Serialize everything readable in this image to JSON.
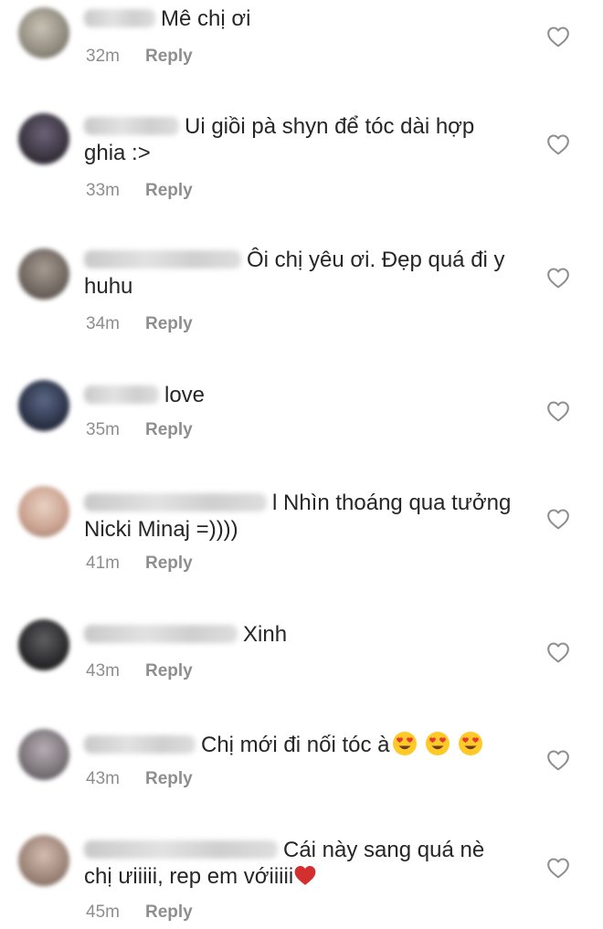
{
  "comments": [
    {
      "text": "Mê chị ơi",
      "time": "32m",
      "reply": "Reply",
      "avatar_color": "#8f8a7e"
    },
    {
      "text": "Ui giồi pà shyn để tóc dài hợp ghia :>",
      "time": "33m",
      "reply": "Reply",
      "avatar_color": "#3a3440"
    },
    {
      "text": "Ôi chị yêu ơi. Đẹp quá đi y huhu",
      "time": "34m",
      "reply": "Reply",
      "avatar_color": "#6f6660"
    },
    {
      "text": "love",
      "time": "35m",
      "reply": "Reply",
      "avatar_color": "#2c3448"
    },
    {
      "text": "l Nhìn thoáng qua tưởng Nicki Minaj =))))",
      "time": "41m",
      "reply": "Reply",
      "avatar_color": "#c9a08f"
    },
    {
      "text": "Xinh",
      "time": "43m",
      "reply": "Reply",
      "avatar_color": "#2a2a2c"
    },
    {
      "text": "Chị mới đi nối tóc à",
      "time": "43m",
      "reply": "Reply",
      "avatar_color": "#7a7378"
    },
    {
      "text": "Cái này sang quá nè chị ưiiiii, rep em vớiiiii",
      "time": "45m",
      "reply": "Reply",
      "avatar_color": "#9c8478"
    }
  ],
  "icons": {
    "like": "heart-outline-icon",
    "emoji_face": "heart-eyes-emoji",
    "emoji_heart": "red-heart-emoji"
  },
  "colors": {
    "text": "#262626",
    "meta": "#8e8e8e",
    "heart_stroke": "#8e8e8e",
    "emoji_heart": "#d32f2f"
  }
}
